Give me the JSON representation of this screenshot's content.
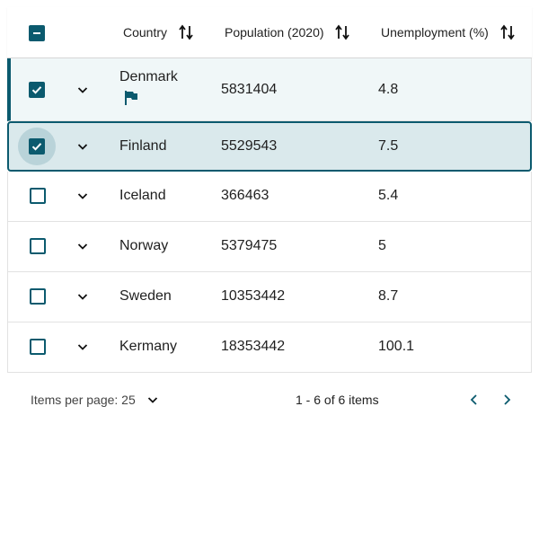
{
  "colors": {
    "accent": "#0b5a6e",
    "selected_row": "#f0f7f8",
    "active_row": "#dae9ec"
  },
  "header": {
    "columns": [
      {
        "label": "Country"
      },
      {
        "label": "Population (2020)"
      },
      {
        "label": "Unemployment (%)"
      }
    ]
  },
  "rows": [
    {
      "country": "Denmark",
      "population": "5831404",
      "unemployment": "4.8",
      "checked": true,
      "flag_icon": "flag-icon"
    },
    {
      "country": "Finland",
      "population": "5529543",
      "unemployment": "7.5",
      "checked": true
    },
    {
      "country": "Iceland",
      "population": "366463",
      "unemployment": "5.4",
      "checked": false
    },
    {
      "country": "Norway",
      "population": "5379475",
      "unemployment": "5",
      "checked": false
    },
    {
      "country": "Sweden",
      "population": "10353442",
      "unemployment": "8.7",
      "checked": false
    },
    {
      "country": "Kermany",
      "population": "18353442",
      "unemployment": "100.1",
      "checked": false
    }
  ],
  "footer": {
    "items_per_page_label": "Items per page: 25",
    "range_text": "1 - 6 of 6 items"
  }
}
